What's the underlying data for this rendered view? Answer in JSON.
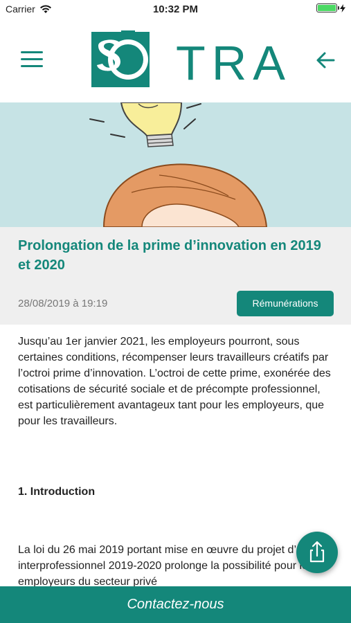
{
  "status_bar": {
    "carrier": "Carrier",
    "time": "10:32 PM"
  },
  "header": {
    "logo_text": "TRA",
    "brand_color": "#14877a",
    "menu_icon": "hamburger-icon",
    "back_icon": "arrow-left-icon"
  },
  "article": {
    "title": "Prolongation de la prime d’innovation en 2019 et 2020",
    "date": "28/08/2019 à 19:19",
    "category": "Rémunérations",
    "intro": "Jusqu’au 1er janvier 2021, les employeurs pourront, sous certaines conditions, récompenser leurs travailleurs créatifs par l’octroi prime d’innovation. L’octroi de cette prime, exonérée des cotisations de sécurité sociale et de précompte professionnel, est particulièrement avantageux tant pour les employeurs, que pour les travailleurs.",
    "section_heading": "1. Introduction",
    "paragraph_2": "La loi du 26 mai 2019 portant mise en œuvre du projet d’accord interprofessionnel 2019-2020 prolonge la possibilité pour les employeurs du secteur privé"
  },
  "share_icon": "share-icon",
  "footer": {
    "contact_label": "Contactez-nous"
  }
}
